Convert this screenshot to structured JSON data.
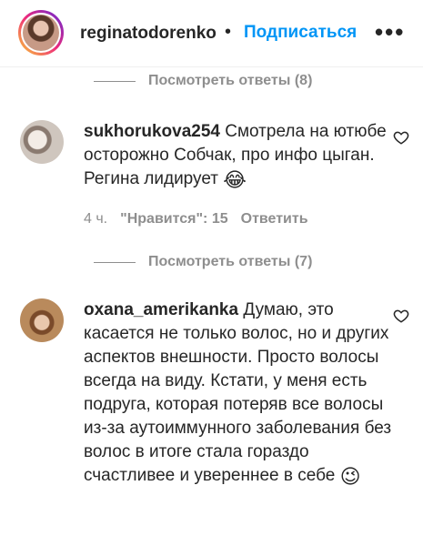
{
  "header": {
    "username": "reginatodorenko",
    "separator": "•",
    "follow_label": "Подписаться",
    "more_label": "•••"
  },
  "replies_1": {
    "label": "Посмотреть ответы (8)"
  },
  "comments": [
    {
      "username": "sukhorukova254",
      "text": "Смотрела на ютюбе осторожно Собчак, про инфо цыган. Регина лидирует",
      "emoji": "😂",
      "time": "4 ч.",
      "likes": "\"Нравится\": 15",
      "reply_label": "Ответить"
    },
    {
      "username": "oxana_amerikanka",
      "text": "Думаю, это касается не только волос, но и других аспектов внешности. Просто волосы всегда на виду. Кстати, у меня есть подруга, которая потеряв все волосы из-за аутоиммунного заболевания без волос в итоге стала гораздо счастливее и увереннее в себе",
      "emoji": "😉"
    }
  ],
  "replies_2": {
    "label": "Посмотреть ответы (7)"
  },
  "colors": {
    "accent": "#0095f6",
    "muted": "#8e8e8e",
    "text": "#262626"
  }
}
